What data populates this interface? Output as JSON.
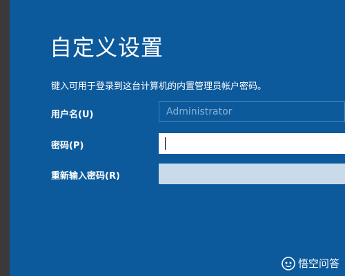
{
  "page": {
    "title": "自定义设置",
    "instruction": "键入可用于登录到这台计算机的内置管理员帐户密码。"
  },
  "form": {
    "username_label": "用户名(U)",
    "username_value": "Administrator",
    "password_label": "密码(P)",
    "password_value": "",
    "reenter_label": "重新输入密码(R)",
    "reenter_value": ""
  },
  "watermark": {
    "text": "悟空问答"
  },
  "colors": {
    "background": "#0c5a9c",
    "left_bar": "#3a3a3a",
    "field_active": "#ffffff",
    "field_disabled": "#c9dbea"
  }
}
